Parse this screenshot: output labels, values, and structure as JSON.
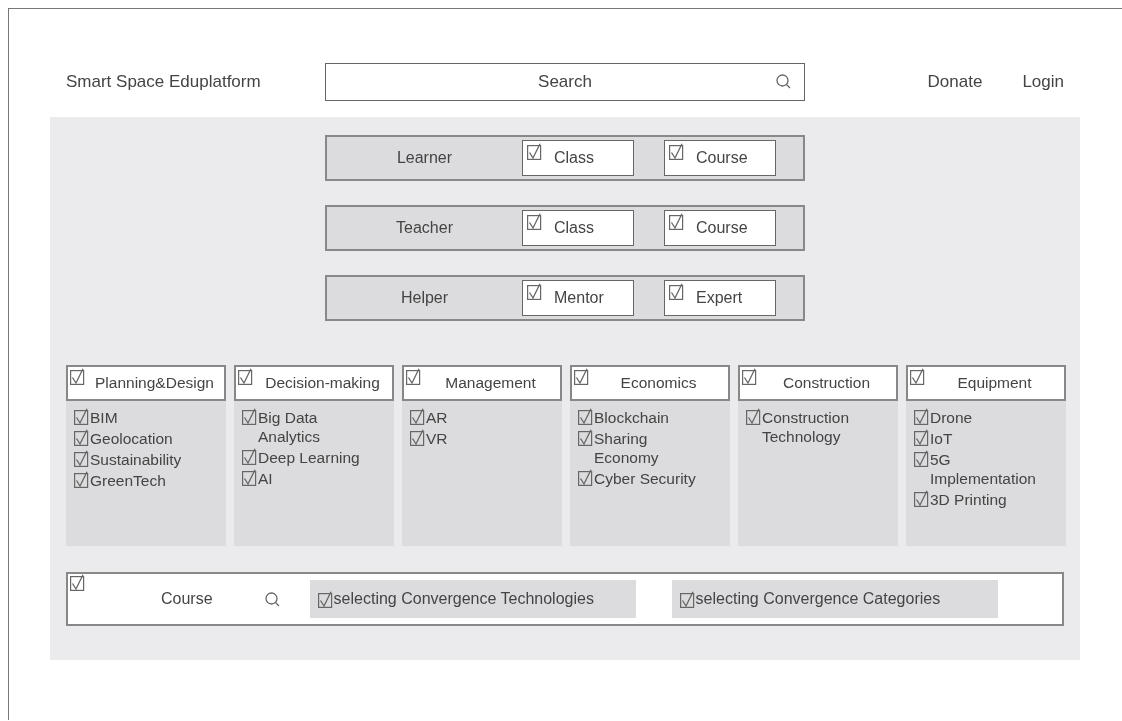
{
  "header": {
    "brand": "Smart Space Eduplatform",
    "search": {
      "placeholder": "Search"
    },
    "nav": [
      "Donate",
      "Login"
    ]
  },
  "roles": [
    {
      "label": "Learner",
      "options": [
        {
          "label": "Class",
          "checked": true
        },
        {
          "label": "Course",
          "checked": true
        }
      ]
    },
    {
      "label": "Teacher",
      "options": [
        {
          "label": "Class",
          "checked": true
        },
        {
          "label": "Course",
          "checked": true
        }
      ]
    },
    {
      "label": "Helper",
      "options": [
        {
          "label": "Mentor",
          "checked": true
        },
        {
          "label": "Expert",
          "checked": true
        }
      ]
    }
  ],
  "categories": [
    {
      "label": "Planning&Design",
      "checked": true,
      "items": [
        {
          "label": "BIM",
          "checked": true
        },
        {
          "label": "Geolocation",
          "checked": true
        },
        {
          "label": "Sustainability",
          "checked": true
        },
        {
          "label": "GreenTech",
          "checked": true
        }
      ]
    },
    {
      "label": "Decision-making",
      "checked": true,
      "items": [
        {
          "label": "Big Data Analytics",
          "checked": true
        },
        {
          "label": "Deep Learning",
          "checked": true
        },
        {
          "label": "AI",
          "checked": true
        }
      ]
    },
    {
      "label": "Management",
      "checked": true,
      "items": [
        {
          "label": "AR",
          "checked": true
        },
        {
          "label": "VR",
          "checked": true
        }
      ]
    },
    {
      "label": "Economics",
      "checked": true,
      "items": [
        {
          "label": "Blockchain",
          "checked": true
        },
        {
          "label": "Sharing Economy",
          "checked": true
        },
        {
          "label": "Cyber Security",
          "checked": true
        }
      ]
    },
    {
      "label": "Construction",
      "checked": true,
      "items": [
        {
          "label": "Construction Technology",
          "checked": true
        }
      ]
    },
    {
      "label": "Equipment",
      "checked": true,
      "items": [
        {
          "label": "Drone",
          "checked": true
        },
        {
          "label": "IoT",
          "checked": true
        },
        {
          "label": "5G Implementation",
          "checked": true
        },
        {
          "label": "3D Printing",
          "checked": true
        }
      ]
    }
  ],
  "course_bar": {
    "checked": true,
    "label": "Course",
    "filters": [
      {
        "label": "selecting Convergence Technologies",
        "checked": true
      },
      {
        "label": "selecting Convergence Categories",
        "checked": true
      }
    ]
  }
}
